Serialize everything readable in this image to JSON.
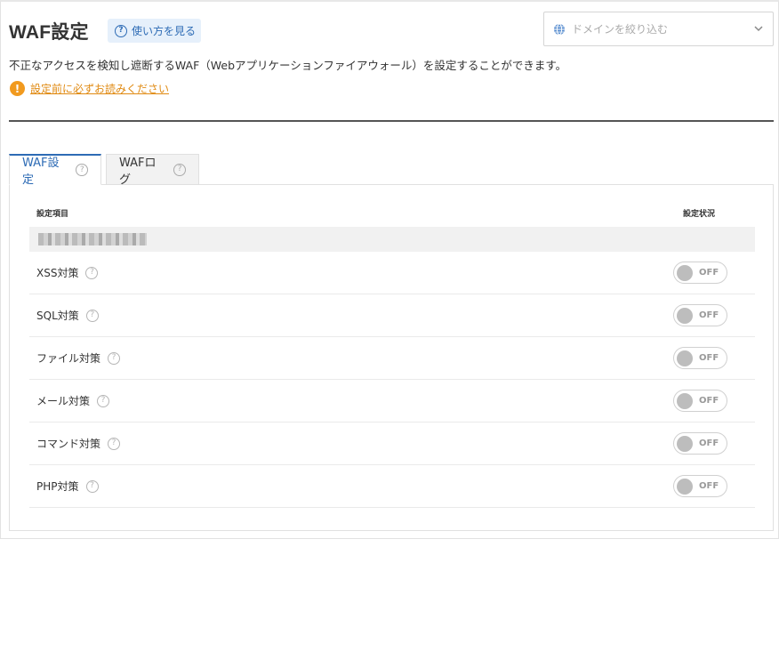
{
  "header": {
    "title": "WAF設定",
    "howto_label": "使い方を見る",
    "domain_filter_placeholder": "ドメインを絞り込む",
    "description": "不正なアクセスを検知し遮断するWAF（Webアプリケーションファイアウォール）を設定することができます。",
    "warning_link": "設定前に必ずお読みください"
  },
  "tabs": [
    {
      "label": "WAF設定",
      "active": true
    },
    {
      "label": "WAFログ",
      "active": false
    }
  ],
  "table": {
    "col_item": "設定項目",
    "col_status": "設定状況",
    "rows": [
      {
        "label": "XSS対策",
        "status": "OFF"
      },
      {
        "label": "SQL対策",
        "status": "OFF"
      },
      {
        "label": "ファイル対策",
        "status": "OFF"
      },
      {
        "label": "メール対策",
        "status": "OFF"
      },
      {
        "label": "コマンド対策",
        "status": "OFF"
      },
      {
        "label": "PHP対策",
        "status": "OFF"
      }
    ]
  },
  "colors": {
    "accent": "#2d6bb5",
    "warning": "#f19a1f",
    "toggle_off": "#bdbdbd"
  }
}
